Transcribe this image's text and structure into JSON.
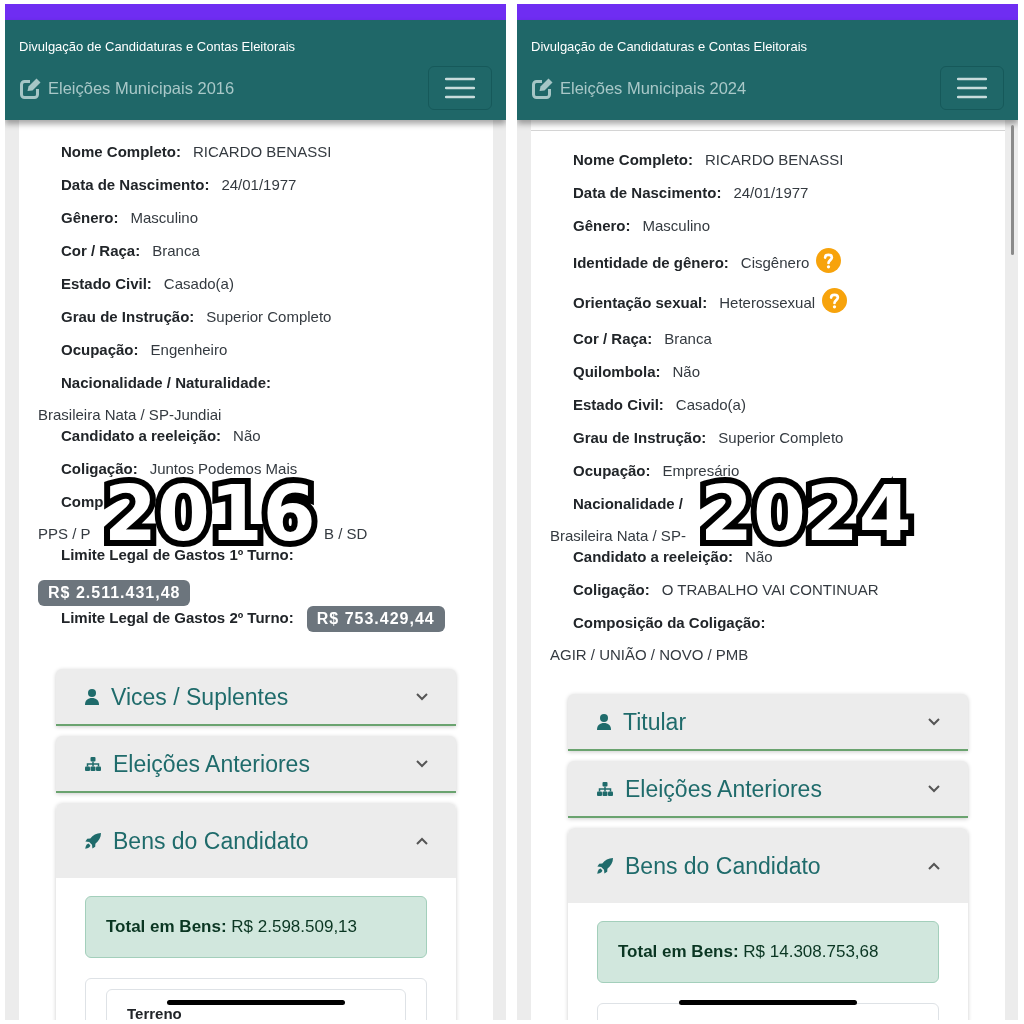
{
  "panels": [
    {
      "header": {
        "site_title": "Divulgação de Candidaturas e Contas Eleitorais",
        "election": "Eleições Municipais 2016"
      },
      "fields": [
        {
          "kind": "field",
          "label": "Nome Completo:",
          "value": "RICARDO BENASSI"
        },
        {
          "kind": "field",
          "label": "Data de Nascimento:",
          "value": "24/01/1977"
        },
        {
          "kind": "field",
          "label": "Gênero:",
          "value": "Masculino"
        },
        {
          "kind": "field",
          "label": "Cor / Raça:",
          "value": "Branca"
        },
        {
          "kind": "field",
          "label": "Estado Civil:",
          "value": "Casado(a)"
        },
        {
          "kind": "field",
          "label": "Grau de Instrução:",
          "value": "Superior Completo"
        },
        {
          "kind": "field",
          "label": "Ocupação:",
          "value": "Engenheiro"
        },
        {
          "kind": "field",
          "label": "Nacionalidade / Naturalidade:"
        },
        {
          "kind": "line",
          "texts": [
            "Brasileira Nata / SP-Jundiai"
          ]
        },
        {
          "kind": "field",
          "label": "Candidato a reeleição:",
          "value": "Não"
        },
        {
          "kind": "field",
          "label": "Coligação:",
          "value": "Juntos Podemos Mais"
        },
        {
          "kind": "field",
          "label": "Comp"
        },
        {
          "kind": "line",
          "texts": [
            "PPS / P",
            "B / SD"
          ]
        },
        {
          "kind": "field",
          "label": "Limite Legal de Gastos 1º Turno:"
        },
        {
          "kind": "badge",
          "text": "R$ 2.511.431,48"
        },
        {
          "kind": "field",
          "label": "Limite Legal de Gastos 2º Turno:",
          "badge": "R$ 753.429,44"
        }
      ],
      "overlay": "2016",
      "accordions": [
        {
          "title": "Vices / Suplentes",
          "expanded": false
        },
        {
          "title": "Eleições Anteriores",
          "expanded": false
        },
        {
          "title": "Bens do Candidato",
          "expanded": true,
          "total": "**Total em Bens:** R$ 2.598.509,13",
          "assets": [
            "Terreno"
          ]
        }
      ]
    },
    {
      "header": {
        "site_title": "Divulgação de Candidaturas e Contas Eleitorais",
        "election": "Eleições Municipais 2024"
      },
      "card_top_rule": true,
      "scrollbar": true,
      "fields": [
        {
          "kind": "field",
          "label": "Nome Completo:",
          "value": "RICARDO BENASSI"
        },
        {
          "kind": "field",
          "label": "Data de Nascimento:",
          "value": "24/01/1977"
        },
        {
          "kind": "field",
          "label": "Gênero:",
          "value": "Masculino"
        },
        {
          "kind": "field",
          "label": "Identidade de gênero:",
          "value": "Cisgênero",
          "help": true
        },
        {
          "kind": "field",
          "label": "Orientação sexual:",
          "value": "Heterossexual",
          "help": true
        },
        {
          "kind": "field",
          "label": "Cor / Raça:",
          "value": "Branca"
        },
        {
          "kind": "field",
          "label": "Quilombola:",
          "value": "Não"
        },
        {
          "kind": "field",
          "label": "Estado Civil:",
          "value": "Casado(a)"
        },
        {
          "kind": "field",
          "label": "Grau de Instrução:",
          "value": "Superior Completo"
        },
        {
          "kind": "field",
          "label": "Ocupação:",
          "value": "Empresário"
        },
        {
          "kind": "field",
          "label": "Nacionalidade /"
        },
        {
          "kind": "line",
          "texts": [
            "Brasileira Nata / SP-"
          ]
        },
        {
          "kind": "field",
          "label": "Candidato a reeleição:",
          "value": "Não"
        },
        {
          "kind": "field",
          "label": "Coligação:",
          "value": "O TRABALHO VAI CONTINUAR"
        },
        {
          "kind": "field",
          "label": "Composição da Coligação:"
        },
        {
          "kind": "line",
          "texts": [
            "AGIR / UNIÃO / NOVO / PMB"
          ]
        }
      ],
      "overlay": "2024",
      "accordions": [
        {
          "title": "Titular",
          "expanded": false
        },
        {
          "title": "Eleições Anteriores",
          "expanded": false
        },
        {
          "title": "Bens do Candidato",
          "expanded": true,
          "total": "**Total em Bens:** R$ 14.308.753,68"
        }
      ]
    }
  ]
}
